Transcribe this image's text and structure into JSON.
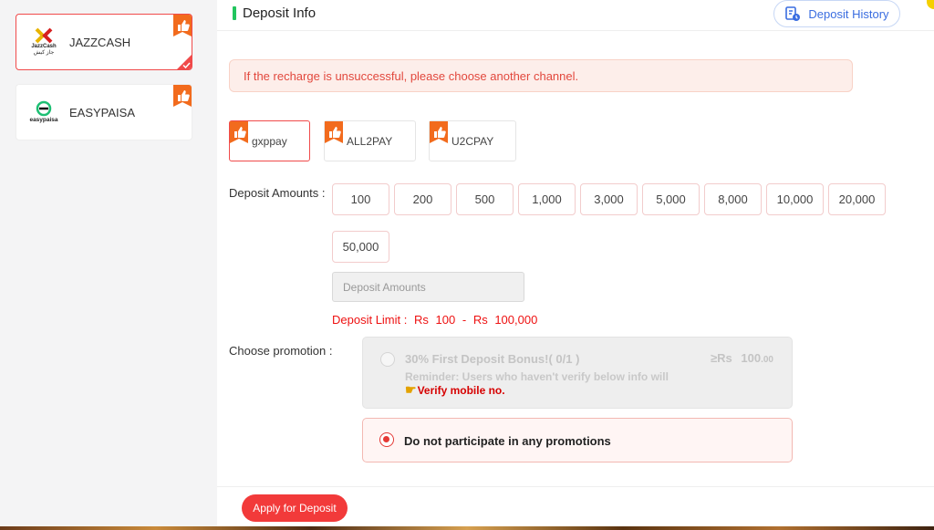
{
  "sidebar": {
    "channels": [
      {
        "label": "JAZZCASH",
        "logo_text": "JazzCash",
        "logo_sub": "جاز کیش",
        "selected": true
      },
      {
        "label": "EASYPAISA",
        "logo_text": "easypaisa",
        "selected": false
      }
    ]
  },
  "header": {
    "title": "Deposit Info",
    "history_label": "Deposit History"
  },
  "alert": {
    "text": "If the recharge is unsuccessful, please choose another channel."
  },
  "sub_channels": [
    {
      "label": "gxppay",
      "selected": true
    },
    {
      "label": "ALL2PAY",
      "selected": false
    },
    {
      "label": "U2CPAY",
      "selected": false
    }
  ],
  "deposit": {
    "amounts_label": "Deposit Amounts :",
    "amounts": [
      "100",
      "200",
      "500",
      "1,000",
      "3,000",
      "5,000",
      "8,000",
      "10,000",
      "20,000",
      "50,000"
    ],
    "input_placeholder": "Deposit Amounts",
    "limit": {
      "label": "Deposit Limit :",
      "currency": "Rs",
      "min": "100",
      "sep": "-",
      "max": "100,000"
    }
  },
  "promotion": {
    "label": "Choose promotion :",
    "options": [
      {
        "title": "30% First Deposit Bonus!( 0/1 )",
        "min_prefix": "≥Rs",
        "min_value": "100",
        "min_decimals": ".00",
        "reminder": "Reminder: Users who haven't verify below info will",
        "verify": "Verify mobile no.",
        "disabled": true
      },
      {
        "title": "Do not participate in any promotions",
        "selected": true
      }
    ]
  },
  "footer": {
    "apply_label": "Apply for Deposit"
  },
  "colors": {
    "accent": "#f23a3a",
    "link_blue": "#3a6de0",
    "title_bar": "#22c55e",
    "badge_orange": "#f26b1d"
  }
}
